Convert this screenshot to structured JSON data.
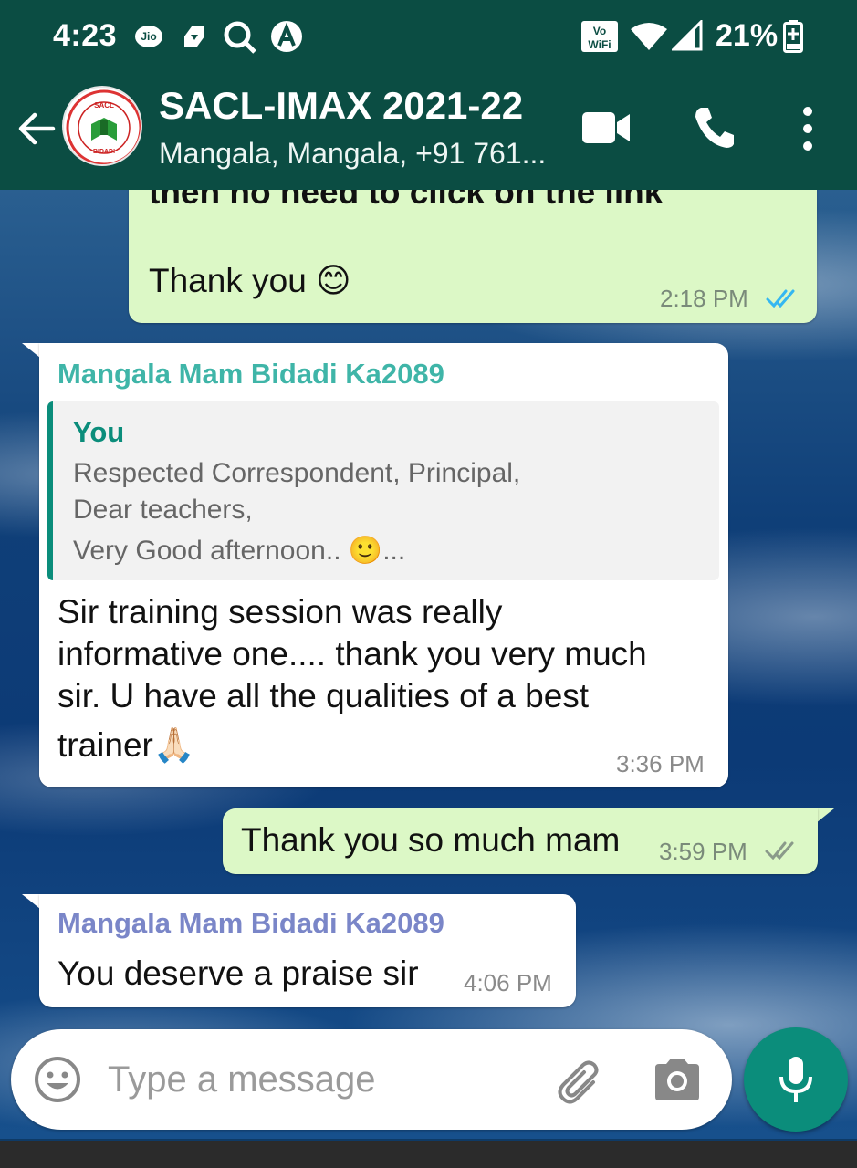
{
  "status_bar": {
    "time": "4:23",
    "carrier": "Jio",
    "battery": "21%",
    "icons": [
      "jio-icon",
      "navigation-app-icon",
      "search-icon",
      "app-a-icon",
      "vowifi-icon",
      "wifi-icon",
      "signal-icon",
      "battery-charging-icon"
    ]
  },
  "header": {
    "title": "SACL-IMAX 2021-22",
    "subtitle": "Mangala, Mangala, +91 761...",
    "avatar_text_top": "SACL",
    "avatar_text_bottom": "BIDADI"
  },
  "messages": [
    {
      "direction": "out",
      "partial_text": "then no need to click on the link",
      "text": "Thank you 😊",
      "time": "2:18 PM",
      "status": "read"
    },
    {
      "direction": "in",
      "sender": "Mangala Mam Bidadi Ka2089",
      "sender_color": "#3fb5a8",
      "quote": {
        "author": "You",
        "line1": "Respected Correspondent, Principal,",
        "line2": "Dear teachers,",
        "line3": "Very Good afternoon.. 🙂..."
      },
      "text_lines": [
        "Sir training session was really",
        "informative one.... thank you very much",
        "sir. U have all the qualities of a best",
        "trainer🙏🏻"
      ],
      "time": "3:36 PM"
    },
    {
      "direction": "out",
      "text": "Thank you so much mam",
      "time": "3:59 PM",
      "status": "delivered"
    },
    {
      "direction": "in",
      "sender": "Mangala Mam Bidadi Ka2089",
      "sender_color": "#7a86c8",
      "text": "You deserve a praise sir",
      "time": "4:06 PM"
    }
  ],
  "composer": {
    "placeholder": "Type a message"
  },
  "colors": {
    "header": "#0b4d43",
    "outgoing_bubble": "#dcf8c6",
    "incoming_bubble": "#ffffff",
    "read_tick": "#34b7f1",
    "mic_button": "#0b8d7b"
  }
}
